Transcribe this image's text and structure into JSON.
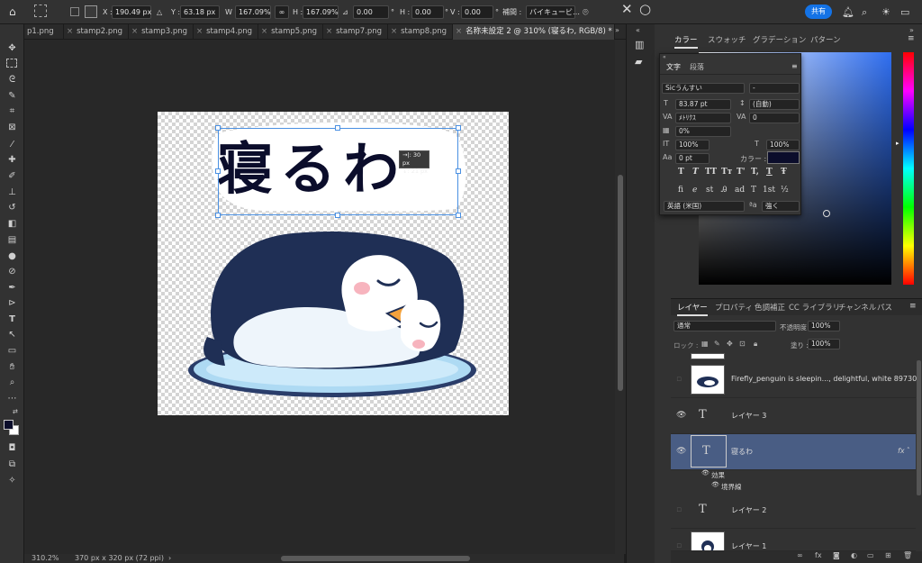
{
  "options_bar": {
    "x_label": "X :",
    "x_value": "190.49 px",
    "y_label": "Y :",
    "y_value": "63.18 px",
    "w_label": "W :",
    "w_value": "167.09%",
    "h_label": "H :",
    "h_value": "167.09%",
    "rotate_value": "0.00",
    "hskew_label": "H :",
    "hskew_value": "0.00",
    "vskew_label": "V :",
    "vskew_value": "0.00",
    "degree_unit": "°",
    "interp_label": "補間 :",
    "interp_value": "バイキュービ…",
    "share_label": "共有"
  },
  "tabs": [
    {
      "label": "p1.png",
      "active": false
    },
    {
      "label": "stamp2.png",
      "active": false
    },
    {
      "label": "stamp3.png",
      "active": false
    },
    {
      "label": "stamp4.png",
      "active": false
    },
    {
      "label": "stamp5.png",
      "active": false
    },
    {
      "label": "stamp7.png",
      "active": false
    },
    {
      "label": "stamp8.png",
      "active": false
    },
    {
      "label": "名称未設定 2 @ 310% (寝るわ, RGB/8) *",
      "active": true
    }
  ],
  "canvas": {
    "text": "寝るわ",
    "tooltip_line1": "→|: 30 px",
    "tooltip_line2": "↓: 21 px",
    "checker_light": "#ffffff",
    "checker_dark": "#d4d4d4"
  },
  "status": {
    "zoom": "310.2%",
    "doc_size": "370 px x 320 px (72 ppi)"
  },
  "color_panel": {
    "tabs": [
      "カラー",
      "スウォッチ",
      "グラデーション",
      "パターン"
    ],
    "base_hue": "#2f6ef0"
  },
  "character_panel": {
    "tabs": [
      "文字",
      "段落"
    ],
    "font_family": "Sicうんすい",
    "font_style": "-",
    "font_size": "83.87 pt",
    "leading": "(自動)",
    "kerning": "ﾒﾄﾘｸｽ",
    "tracking": "0",
    "tsume": "0%",
    "vscale": "100%",
    "hscale": "100%",
    "baseline": "0 pt",
    "color_label": "カラー :",
    "color": "#0b0d2b",
    "language": "英語 (米国)",
    "antialias": "強く",
    "glyphs_row1": [
      "T",
      "T",
      "TT",
      "Tт",
      "T'",
      "T,",
      "T",
      "Ŧ"
    ],
    "glyphs_row2": [
      "ﬁ",
      "ℯ",
      "st",
      "Ꭿ",
      "ad",
      "T",
      "1st",
      "½"
    ]
  },
  "layers_panel": {
    "tabs": [
      "レイヤー",
      "プロパティ",
      "色調補正",
      "CC ライブラリ",
      "チャンネル",
      "パス"
    ],
    "blend_mode": "通常",
    "opacity_label": "不透明度 :",
    "opacity": "100%",
    "lock_label": "ロック :",
    "fill_label": "塗り :",
    "fill": "100%",
    "layers": [
      {
        "name": "Firefly_penguin is sleepin..., delightful, white 897306",
        "type": "image",
        "visible": false,
        "selected": false
      },
      {
        "name": "レイヤー 3",
        "type": "text",
        "visible": true,
        "selected": false
      },
      {
        "name": "寝るわ",
        "type": "text",
        "visible": true,
        "selected": true,
        "fx": "fx"
      },
      {
        "name": "レイヤー 2",
        "type": "text",
        "visible": false,
        "selected": false
      },
      {
        "name": "レイヤー 1",
        "type": "image",
        "visible": false,
        "selected": false
      }
    ],
    "effects_label": "効果",
    "stroke_label": "境界線"
  }
}
